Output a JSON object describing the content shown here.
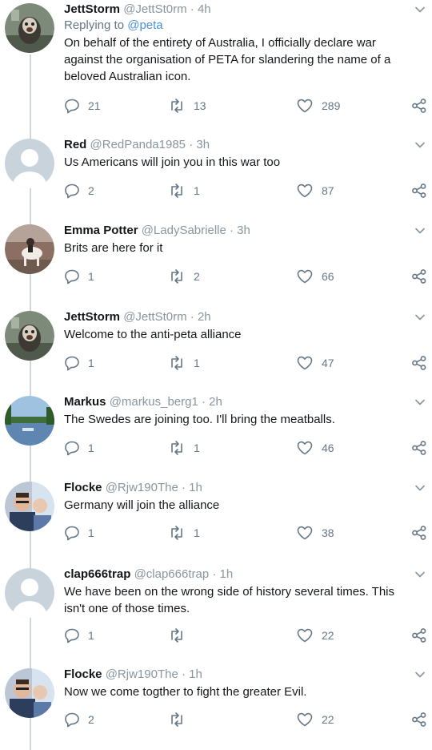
{
  "tweets": [
    {
      "name": "JettStorm",
      "handle": "@JettSt0rm",
      "time": "4h",
      "reply_prefix": "Replying to",
      "reply_to": "@peta",
      "text": "On behalf of the entirety of Australia, I officially declare war against the organisation of PETA for slandering the name of a beloved Australian icon.",
      "replies": "21",
      "retweets": "13",
      "likes": "289",
      "avatar": "monkey-photo"
    },
    {
      "name": "Red",
      "handle": "@RedPanda1985",
      "time": "3h",
      "text": "Us Americans will join you in this war too",
      "replies": "2",
      "retweets": "1",
      "likes": "87",
      "avatar": "default-silhouette"
    },
    {
      "name": "Emma Potter",
      "handle": "@LadySabrielle",
      "time": "3h",
      "text": "Brits are here for it",
      "replies": "1",
      "retweets": "2",
      "likes": "66",
      "avatar": "horse-rider-photo"
    },
    {
      "name": "JettStorm",
      "handle": "@JettSt0rm",
      "time": "2h",
      "text": "Welcome to the anti-peta alliance",
      "replies": "1",
      "retweets": "1",
      "likes": "47",
      "avatar": "monkey-photo"
    },
    {
      "name": "Markus",
      "handle": "@markus_berg1",
      "time": "2h",
      "text": "The Swedes are joining too. I'll bring the meatballs.",
      "replies": "1",
      "retweets": "1",
      "likes": "46",
      "avatar": "lake-landscape-photo"
    },
    {
      "name": "Flocke",
      "handle": "@Rjw190The",
      "time": "1h",
      "text": "Germany will join the alliance",
      "replies": "1",
      "retweets": "1",
      "likes": "38",
      "avatar": "selfie-photo"
    },
    {
      "name": "clap666trap",
      "handle": "@clap666trap",
      "time": "1h",
      "text": "We have been on the wrong side of history several times. This isn't one of those times.",
      "replies": "1",
      "retweets": "",
      "likes": "22",
      "avatar": "default-silhouette"
    },
    {
      "name": "Flocke",
      "handle": "@Rjw190The",
      "time": "1h",
      "text": "Now we come togther to fight the greater Evil.",
      "replies": "2",
      "retweets": "",
      "likes": "22",
      "avatar": "selfie-photo"
    }
  ],
  "separator": "·",
  "icons": {
    "reply": "reply-icon",
    "retweet": "retweet-icon",
    "like": "heart-icon",
    "share": "share-icon",
    "menu": "chevron-down-icon"
  },
  "colors": {
    "muted": "#657786",
    "link": "#4a90d9",
    "thread": "#cfd6dc"
  }
}
